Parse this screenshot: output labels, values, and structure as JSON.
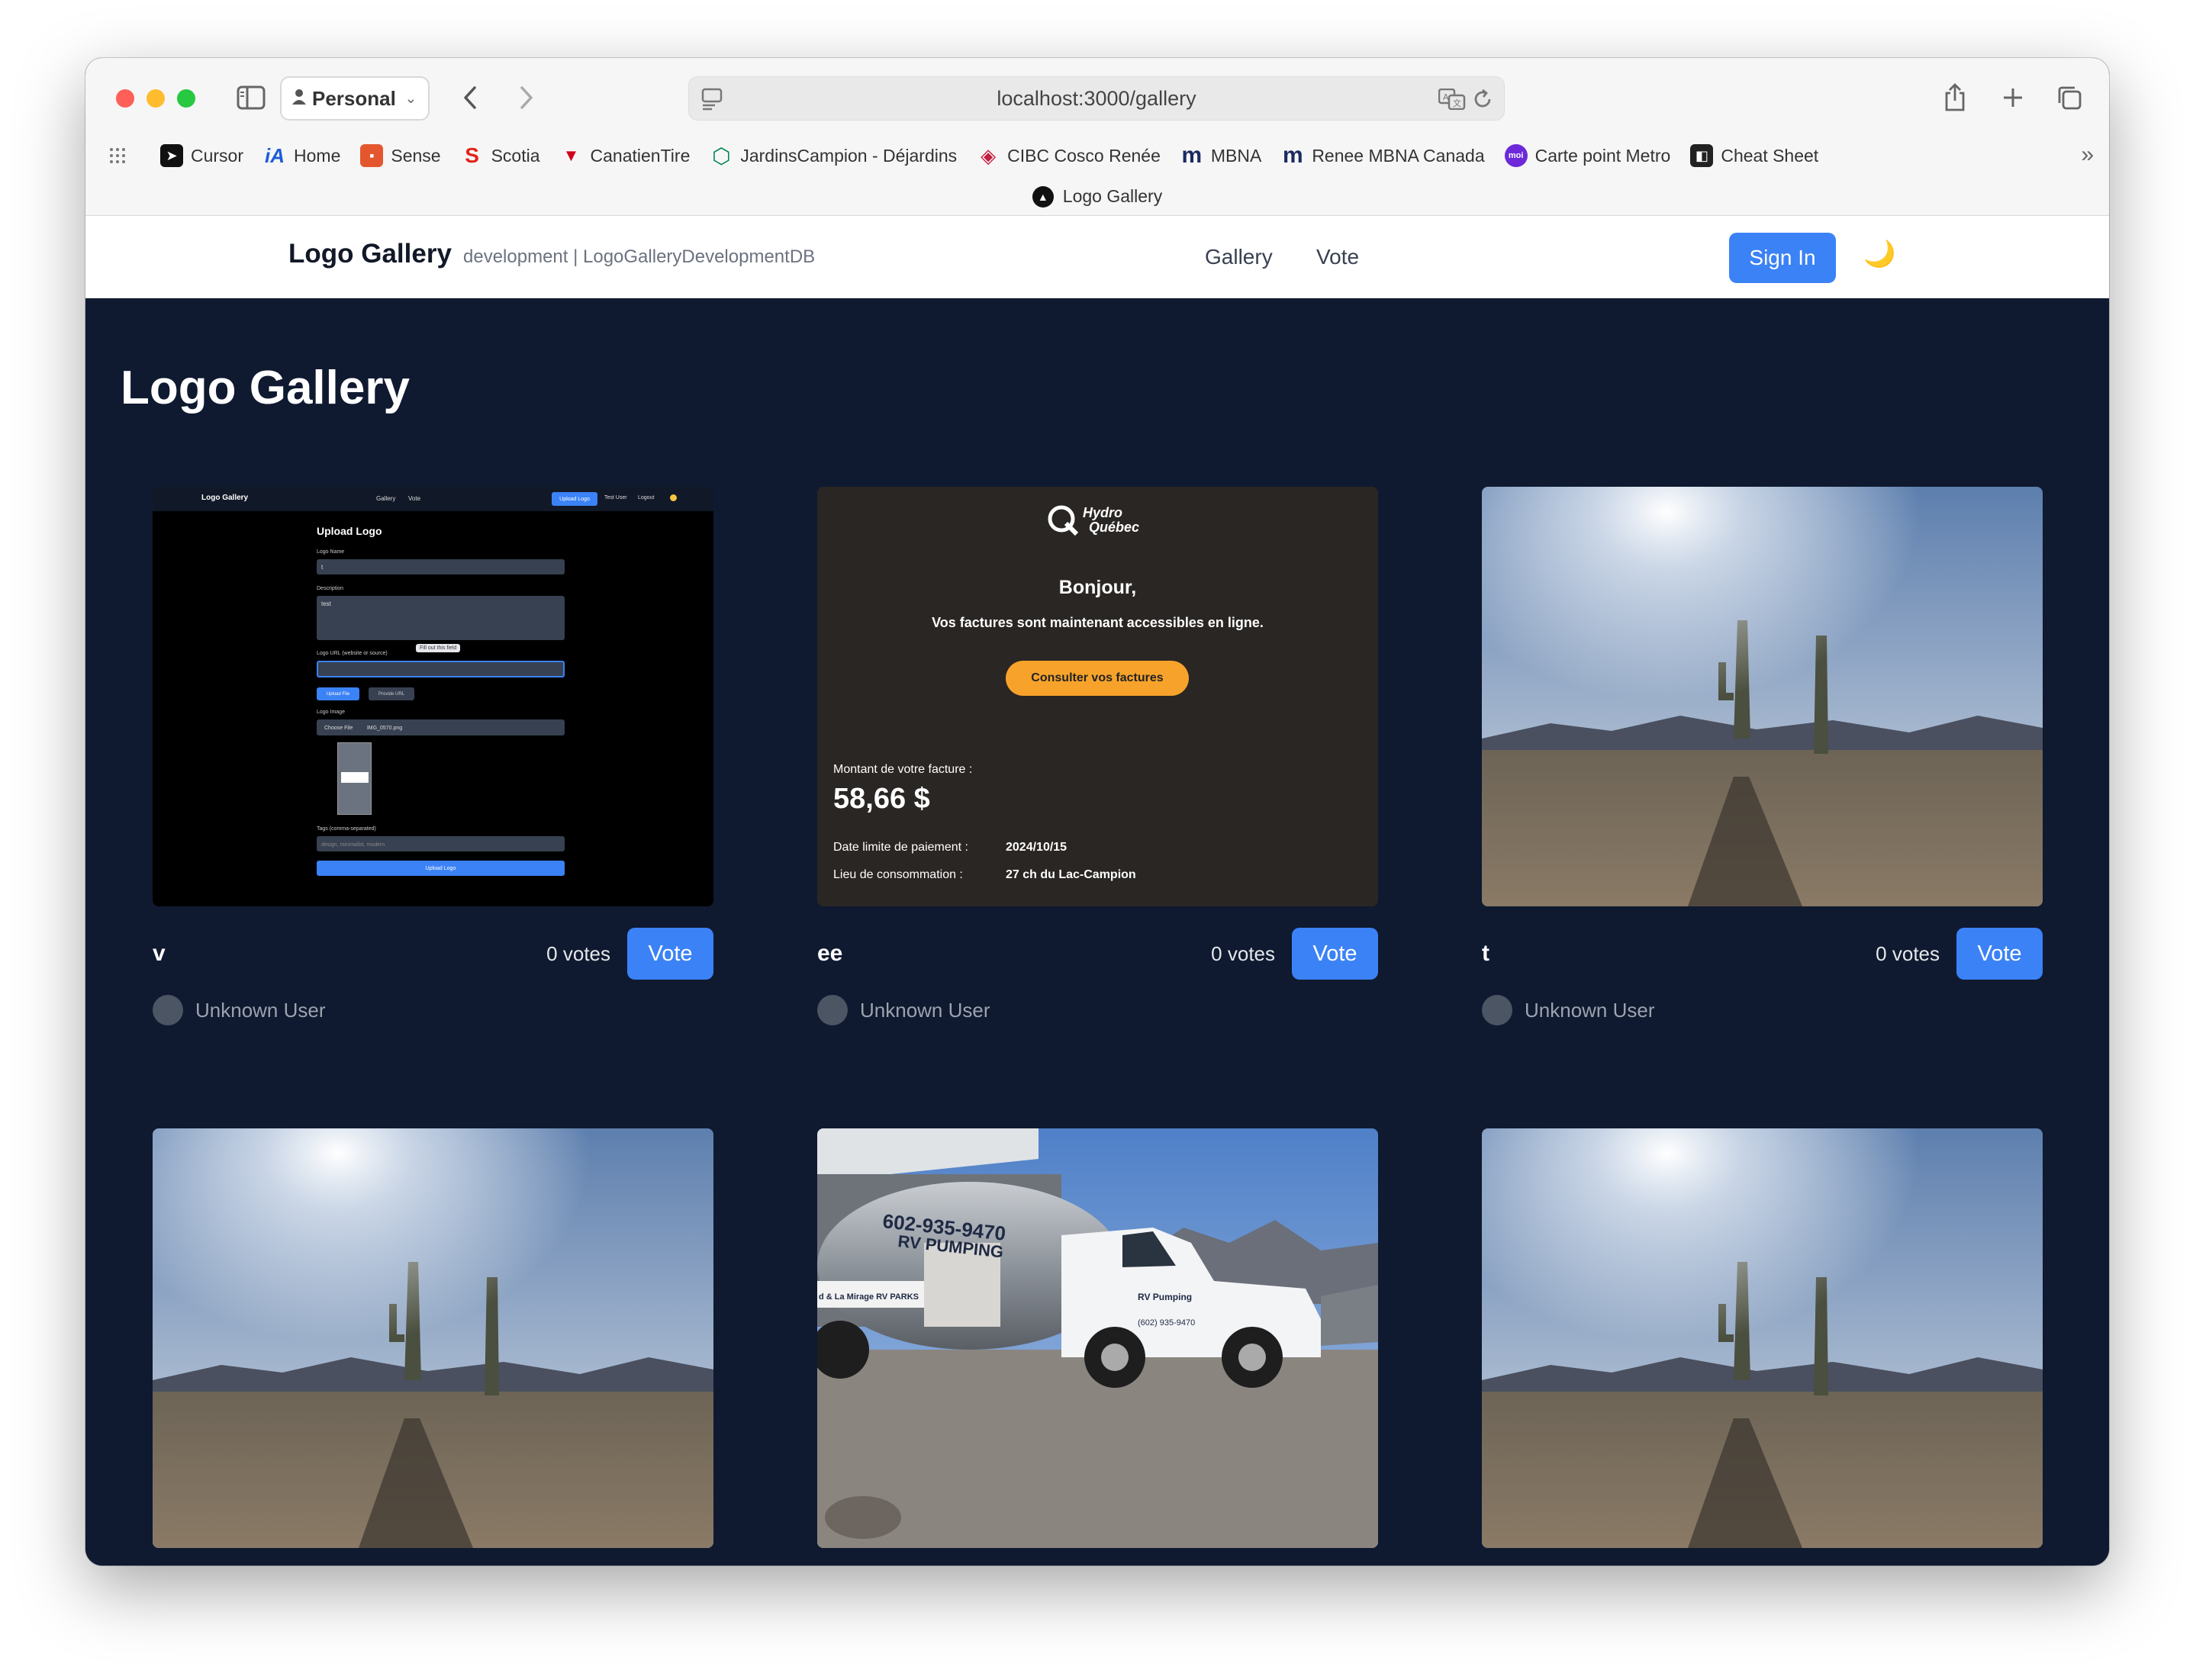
{
  "browser": {
    "profile": "Personal",
    "url": "localhost:3000/gallery",
    "tab_title": "Logo Gallery",
    "bookmarks": [
      {
        "label": "Cursor",
        "icon": "cursor-icon",
        "color": "#111111"
      },
      {
        "label": "Home",
        "icon": "ia-icon",
        "color": "#1e5bd8"
      },
      {
        "label": "Sense",
        "icon": "sense-icon",
        "color": "#e4572e"
      },
      {
        "label": "Scotia",
        "icon": "scotia-icon",
        "color": "#e2231a"
      },
      {
        "label": "CanatienTire",
        "icon": "canadian-tire-icon",
        "color": "#d0021b"
      },
      {
        "label": "JardinsCampion - Déjardins",
        "icon": "desjardins-icon",
        "color": "#00874e"
      },
      {
        "label": "CIBC Cosco Renée",
        "icon": "cibc-icon",
        "color": "#c41f3e"
      },
      {
        "label": "MBNA",
        "icon": "mbna-icon",
        "color": "#1b2a5e"
      },
      {
        "label": "Renee MBNA Canada",
        "icon": "mbna-icon",
        "color": "#1b2a5e"
      },
      {
        "label": "Carte point Metro",
        "icon": "moi-icon",
        "color": "#6d28d9"
      },
      {
        "label": "Cheat Sheet",
        "icon": "cheat-sheet-icon",
        "color": "#222222"
      }
    ]
  },
  "header": {
    "brand": "Logo Gallery",
    "env": "development | LogoGalleryDevelopmentDB",
    "nav": [
      "Gallery",
      "Vote"
    ],
    "signin": "Sign In",
    "theme_icon": "moon-icon"
  },
  "main": {
    "title": "Logo Gallery",
    "cards": [
      {
        "name": "v",
        "votes": "0 votes",
        "vote_label": "Vote",
        "owner": "Unknown User",
        "image": "upload-form-screenshot"
      },
      {
        "name": "ee",
        "votes": "0 votes",
        "vote_label": "Vote",
        "owner": "Unknown User",
        "image": "hydro-quebec-email"
      },
      {
        "name": "t",
        "votes": "0 votes",
        "vote_label": "Vote",
        "owner": "Unknown User",
        "image": "desert-cactus-photo"
      },
      {
        "image": "desert-cactus-photo"
      },
      {
        "image": "rv-pumping-truck-photo"
      },
      {
        "image": "desert-cactus-photo"
      }
    ],
    "mini_screenshot": {
      "brand": "Logo Gallery",
      "nav": [
        "Gallery",
        "Vote"
      ],
      "upload_btn": "Upload Logo",
      "user": "Test User",
      "logout": "Logout",
      "heading": "Upload Logo",
      "name_label": "Logo Name",
      "name_value": "t",
      "desc_label": "Description",
      "desc_value": "test",
      "url_label": "Logo URL (website or source)",
      "tooltip": "Fill out this field",
      "tab_upload": "Upload File",
      "tab_url": "Provide URL",
      "image_label": "Logo Image",
      "choose_file": "Choose File",
      "file_name": "IMG_0570.png",
      "tags_label": "Tags (comma-separated)",
      "tags_placeholder": "design, minimalist, modern",
      "submit": "Upload Logo"
    },
    "hydro_email": {
      "logo_line1": "Hydro",
      "logo_line2": "Québec",
      "greeting": "Bonjour,",
      "message": "Vos factures sont maintenant accessibles en ligne.",
      "button": "Consulter vos factures",
      "amount_label": "Montant de votre facture :",
      "amount": "58,66 $",
      "due_label": "Date limite de paiement :",
      "due_value": "2024/10/15",
      "place_label": "Lieu de consommation :",
      "place_value": "27 ch du Lac-Campion"
    },
    "truck_photo": {
      "tank_phone": "602-935-9470",
      "tank_text": "RV PUMPING",
      "door_text": "RV Pumping",
      "door_phone": "(602) 935-9470",
      "sign_text": "d & La Mirage RV PARKS"
    }
  }
}
